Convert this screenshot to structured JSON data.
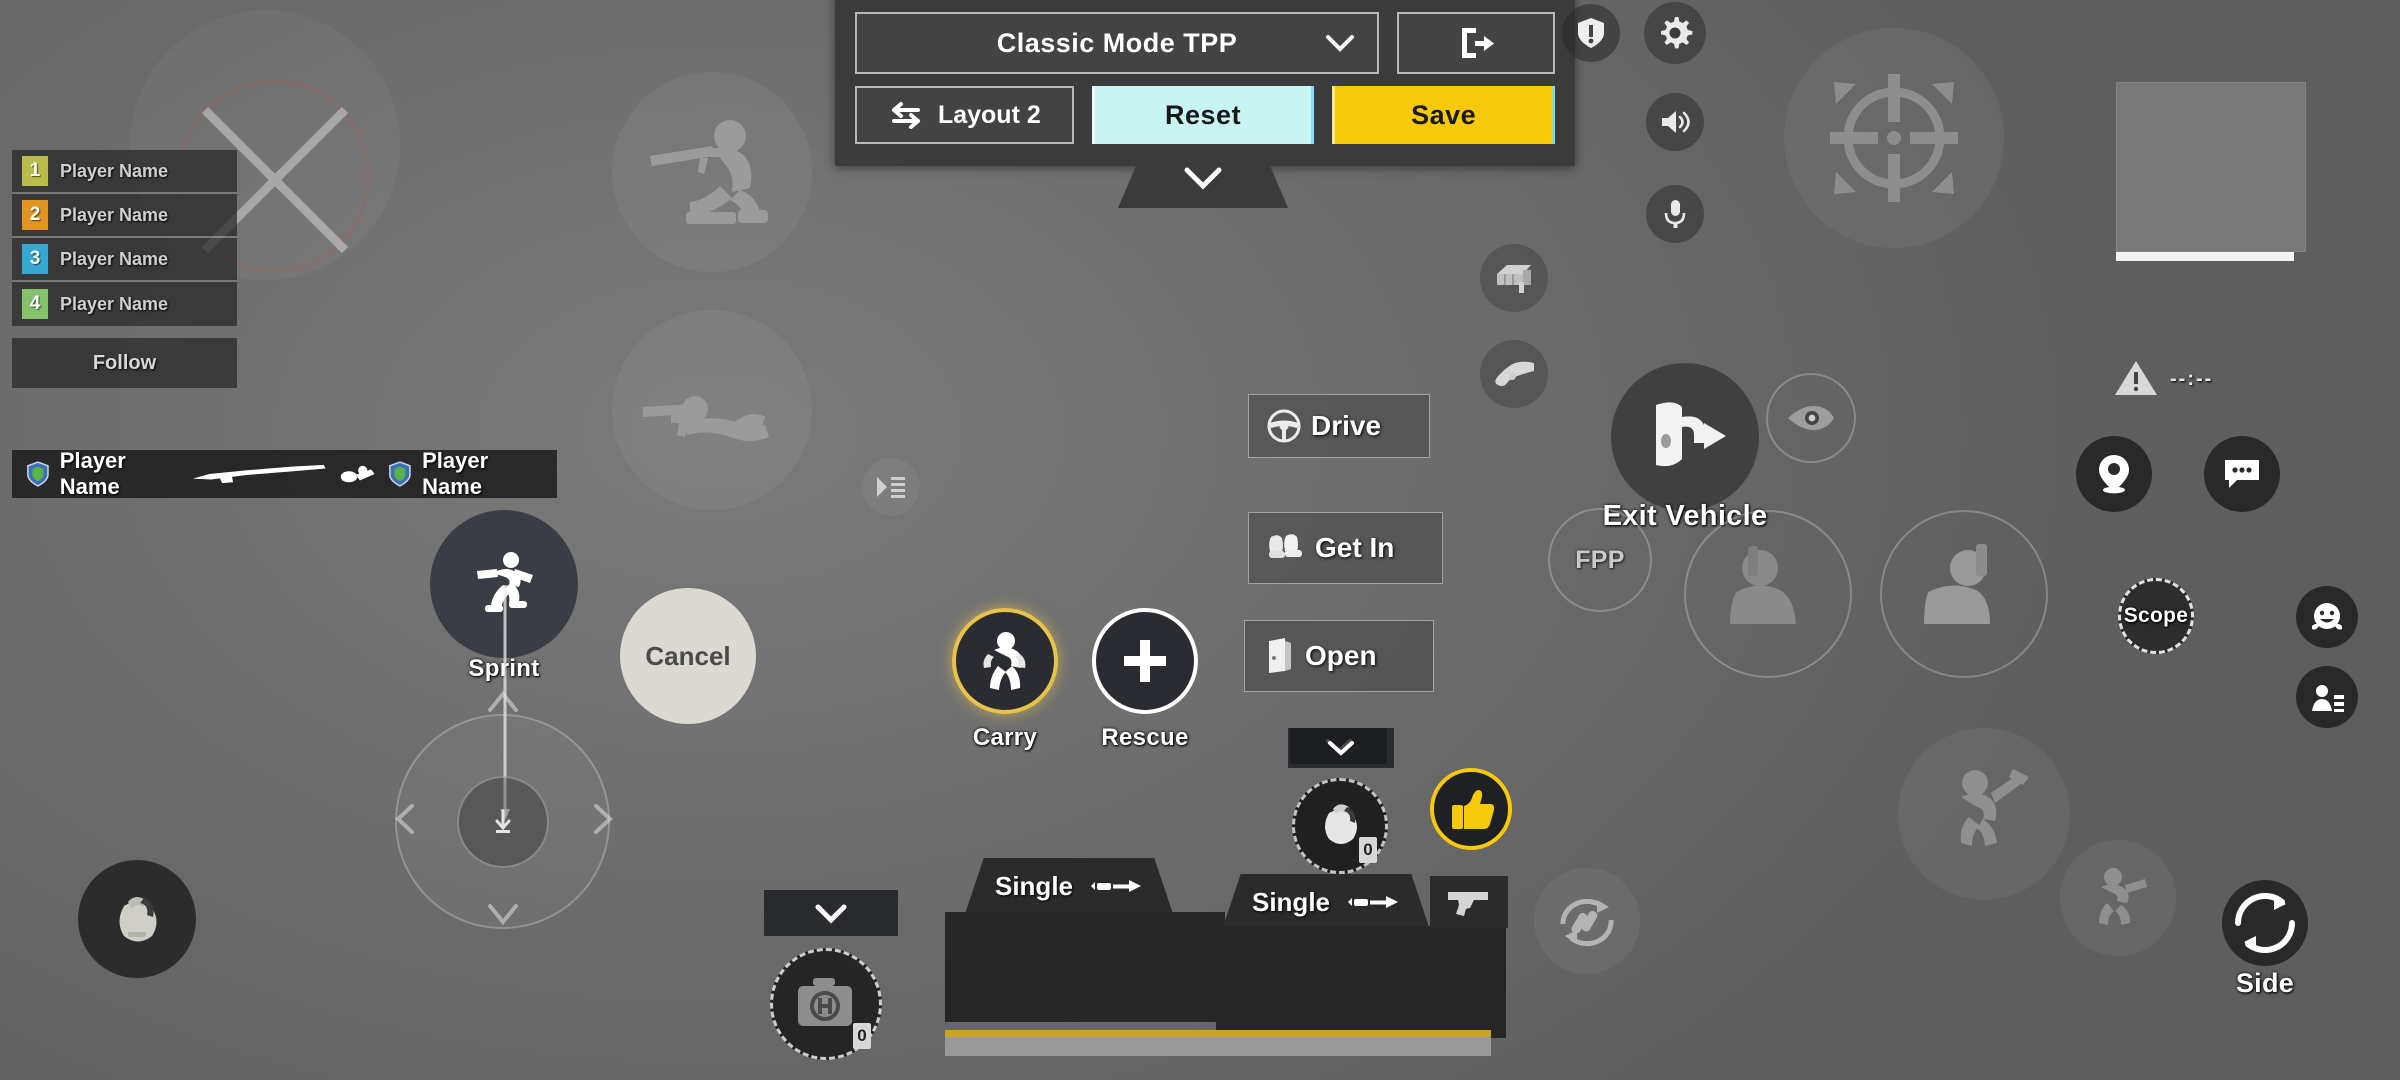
{
  "config_panel": {
    "mode_select": {
      "value": "Classic Mode TPP",
      "icon": "chevron-down-icon"
    },
    "exit_button": {
      "icon": "exit-door-icon"
    },
    "layout_button": {
      "label": "Layout 2",
      "icon": "swap-arrows-icon"
    },
    "reset_button": {
      "label": "Reset",
      "color": "#c8f5f2"
    },
    "save_button": {
      "label": "Save",
      "color": "#f6c90a"
    },
    "collapse_tab": {
      "icon": "chevron-down-icon"
    }
  },
  "team_panel": {
    "rows": [
      {
        "num": "1",
        "name": "Player Name",
        "color": "#b9bc4a"
      },
      {
        "num": "2",
        "name": "Player Name",
        "color": "#e09421"
      },
      {
        "num": "3",
        "name": "Player Name",
        "color": "#37a8cf"
      },
      {
        "num": "4",
        "name": "Player Name",
        "color": "#85c16a"
      }
    ],
    "follow_label": "Follow"
  },
  "kill_feed": {
    "killer": "Player Name",
    "weapon_icon": "rifle-icon",
    "death_icon": "knocked-player-icon",
    "victim": "Player Name"
  },
  "minimap": {
    "timer": "--:--",
    "warning_icon": "warning-triangle-icon"
  },
  "top_right_icons": [
    {
      "name": "report-shield-icon"
    },
    {
      "name": "settings-gear-icon"
    },
    {
      "name": "speaker-icon"
    },
    {
      "name": "microphone-icon"
    }
  ],
  "stance_controls": [
    {
      "name": "crouch-icon"
    },
    {
      "name": "prone-icon"
    },
    {
      "name": "fire-mode-icon"
    }
  ],
  "movement": {
    "sprint_label": "Sprint",
    "sprint_icon": "running-person-icon",
    "joystick_icon": "joystick-dpad",
    "cancel_label": "Cancel"
  },
  "interaction_buttons": [
    {
      "label": "Carry",
      "icon": "carry-person-icon",
      "highlight": "#e8c34a"
    },
    {
      "label": "Rescue",
      "icon": "plus-icon",
      "highlight": "#ffffff"
    }
  ],
  "vehicle_buttons": [
    {
      "label": "Drive",
      "icon": "steering-wheel-icon"
    },
    {
      "label": "Get In",
      "icon": "car-seat-icon"
    },
    {
      "label": "Open",
      "icon": "door-icon"
    }
  ],
  "vehicle_collapse_icon": "chevron-down-icon",
  "exit_vehicle": {
    "label": "Exit Vehicle",
    "icon": "exit-door-icon"
  },
  "fpp_toggle": {
    "label": "FPP",
    "icon": "rotate-arrows-icon"
  },
  "peek_icon": "eye-peek-icon",
  "lean_buttons": [
    {
      "name": "lean-left-icon"
    },
    {
      "name": "lean-right-icon"
    }
  ],
  "vault_icons": [
    {
      "name": "vault-box-icon"
    },
    {
      "name": "pickup-hand-icon"
    }
  ],
  "jump_icon": "jump-person-icon",
  "crouch_run_icon": "crouch-run-icon",
  "right_panel": {
    "map_marker_icon": "map-pin-icon",
    "chat_icon": "chat-bubble-icon",
    "scope_label": "Scope",
    "scope_icon": "scope-reticle-icon",
    "emoji_icon": "smiley-icon",
    "contacts_icon": "person-list-icon"
  },
  "side_button": {
    "label": "Side",
    "icon": "rotate-arrows-icon"
  },
  "weapon_slots": [
    {
      "fire_mode": "Single",
      "fire_icon": "bullet-arrow-icon",
      "ammo_pct": 100
    },
    {
      "fire_mode": "Single",
      "fire_icon": "bullet-arrow-icon",
      "ammo_pct": 100
    }
  ],
  "pistol_slot_icon": "pistol-icon",
  "reload_icon": "reload-ammo-icon",
  "medkit": {
    "icon": "medkit-icon",
    "count": "0",
    "collapse_icon": "chevron-down-icon"
  },
  "throwable": {
    "icon": "grenade-icon",
    "count": "0",
    "collapse_icon": "chevron-down-icon"
  },
  "grenade_left_icon": "grenade-icon",
  "thumbs_up": {
    "icon": "thumbs-up-icon",
    "color": "#f6c90a"
  },
  "aim_crosshair_icon": "crosshair-icon"
}
